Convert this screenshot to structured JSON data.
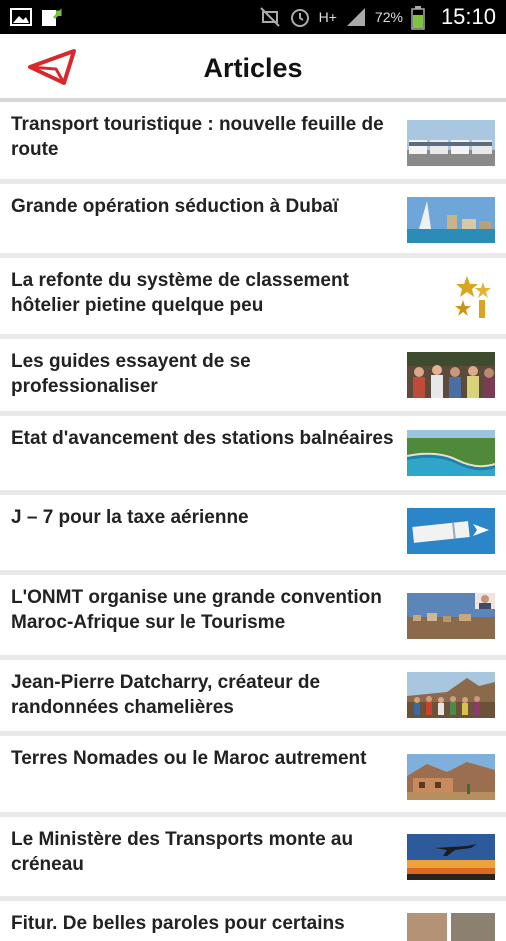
{
  "status_bar": {
    "battery": "72%",
    "network": "H+",
    "time": "15:10",
    "icons": [
      "gallery-icon",
      "upload-icon",
      "mute-icon",
      "alarm-icon",
      "network-icon",
      "signal-icon",
      "battery-icon"
    ]
  },
  "header": {
    "title": "Articles",
    "logo": "app-logo-icon",
    "accent": "#d9282b"
  },
  "articles": [
    {
      "title": "Transport touristique : nouvelle feuille de route",
      "thumb": "tour-buses"
    },
    {
      "title": "Grande opération séduction à Dubaï",
      "thumb": "dubai-skyline"
    },
    {
      "title": "La refonte du système de classement hôtelier pietine quelque peu",
      "thumb": "gold-stars"
    },
    {
      "title": "Les guides essayent de se professionaliser",
      "thumb": "crowd-market"
    },
    {
      "title": "Etat d'avancement des stations balnéaires",
      "thumb": "coastline-aerial"
    },
    {
      "title": "J – 7 pour la taxe aérienne",
      "thumb": "plane-ticket"
    },
    {
      "title": "L'ONMT organise une grande convention Maroc-Afrique sur le Tourisme",
      "thumb": "city-view"
    },
    {
      "title": "Jean-Pierre Datcharry, créateur de randonnées chamelières",
      "thumb": "hikers-group"
    },
    {
      "title": "Terres Nomades ou le Maroc autrement",
      "thumb": "desert-house"
    },
    {
      "title": "Le Ministère des Transports monte au créneau",
      "thumb": "airplane-sunset"
    },
    {
      "title": "Fitur. De belles paroles pour certains",
      "thumb": "partial-thumbnail"
    }
  ]
}
